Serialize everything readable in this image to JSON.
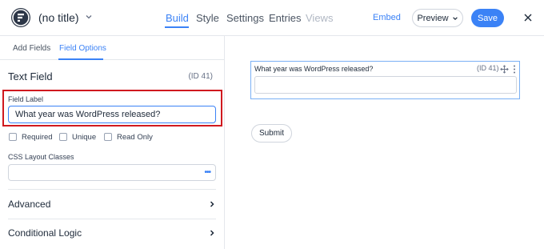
{
  "header": {
    "form_title": "(no title)",
    "nav": [
      {
        "label": "Build",
        "state": "active"
      },
      {
        "label": "Style",
        "state": "normal"
      },
      {
        "label": "Settings",
        "state": "normal"
      },
      {
        "label": "Entries",
        "state": "normal"
      },
      {
        "label": "Views",
        "state": "disabled"
      }
    ],
    "embed_label": "Embed",
    "preview_label": "Preview",
    "save_label": "Save",
    "icons": {
      "logo": "formidable-logo-icon",
      "title_dropdown": "chevron-down-icon",
      "preview_dropdown": "chevron-down-icon",
      "close": "close-icon"
    }
  },
  "sidebar": {
    "tabs": [
      {
        "label": "Add Fields",
        "state": "normal"
      },
      {
        "label": "Field Options",
        "state": "active"
      }
    ],
    "section_title": "Text Field",
    "field_id": "(ID 41)",
    "field_label_caption": "Field Label",
    "field_label_value": "What year was WordPress released?",
    "checkboxes": [
      {
        "label": "Required",
        "checked": false
      },
      {
        "label": "Unique",
        "checked": false
      },
      {
        "label": "Read Only",
        "checked": false
      }
    ],
    "css_caption": "CSS Layout Classes",
    "css_value": "",
    "css_options_icon": "more-dots-icon",
    "accordions": [
      {
        "label": "Advanced",
        "icon": "chevron-right-icon"
      },
      {
        "label": "Conditional Logic",
        "icon": "chevron-right-icon"
      }
    ]
  },
  "canvas": {
    "field_question": "What year was WordPress released?",
    "field_id": "(ID 41)",
    "field_icons": {
      "move": "move-icon",
      "menu": "kebab-menu-icon"
    },
    "submit_label": "Submit"
  },
  "colors": {
    "accent": "#3b82f6",
    "highlight_border": "#d0191f",
    "logo_bg": "#2d3748"
  }
}
